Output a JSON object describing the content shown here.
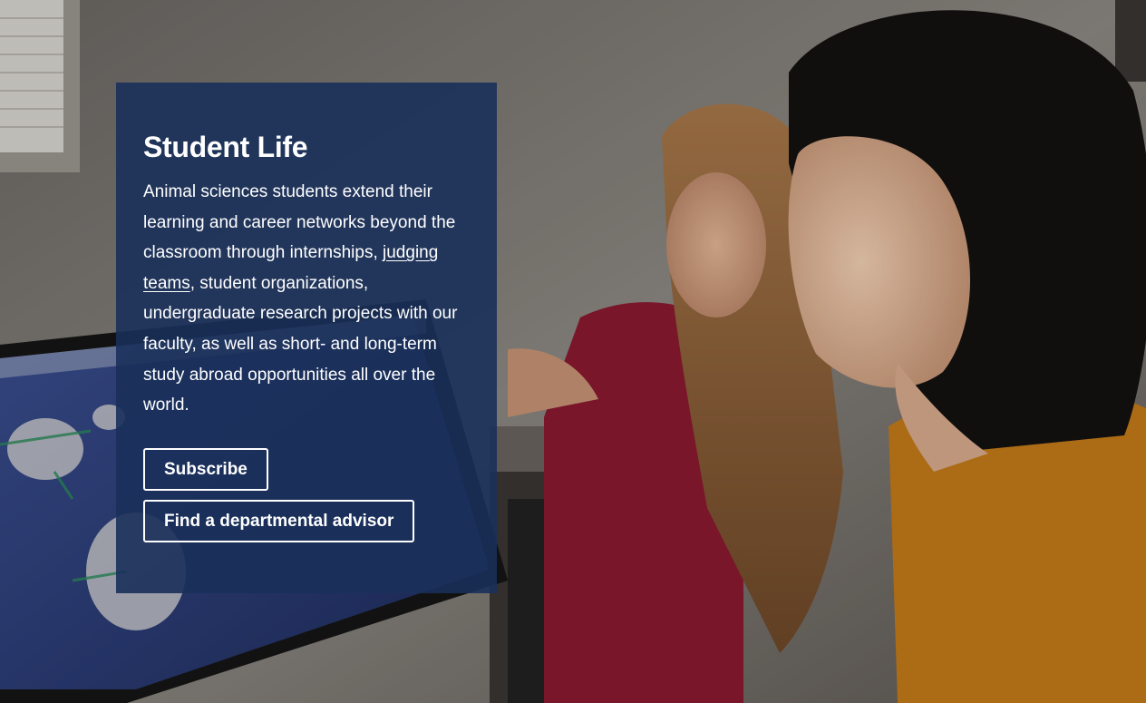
{
  "card": {
    "title": "Student Life",
    "body_part1": "Animal sciences students extend their learning and career networks beyond the classroom through internships, ",
    "body_link": "judging teams",
    "body_part2": ", student organizations, undergraduate research projects with our faculty, as well as short- and long-term study abroad opportunities all over the world.",
    "subscribe_label": "Subscribe",
    "advisor_label": "Find a departmental advisor"
  },
  "colors": {
    "card_background": "#19305A",
    "text": "#FFFFFF"
  }
}
